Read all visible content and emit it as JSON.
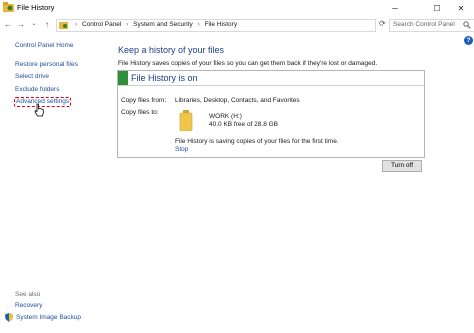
{
  "window": {
    "title": "File History",
    "minimize_glyph": "─",
    "maximize_glyph": "☐",
    "close_glyph": "✕"
  },
  "nav": {
    "back_glyph": "←",
    "forward_glyph": "→",
    "recent_glyph": "⌄",
    "up_glyph": "↑",
    "breadcrumb": [
      "Control Panel",
      "System and Security",
      "File History"
    ],
    "breadcrumb_sep": "›",
    "dropdown_glyph": "⌄",
    "refresh_glyph": "⟳",
    "search_placeholder": "Search Control Panel",
    "help_glyph": "?"
  },
  "sidebar": {
    "home": "Control Panel Home",
    "items": [
      "Restore personal files",
      "Select drive",
      "Exclude folders",
      "Advanced settings"
    ],
    "see_also_label": "See also",
    "see_also": [
      "Recovery",
      "System Image Backup"
    ]
  },
  "main": {
    "heading": "Keep a history of your files",
    "subtitle": "File History saves copies of your files so you can get them back if they're lost or damaged.",
    "status": "File History is on",
    "copy_from_label": "Copy files from:",
    "copy_from_value": "Libraries, Desktop, Contacts, and Favorites",
    "copy_to_label": "Copy files to:",
    "drive_name": "WORK (H:)",
    "drive_free": "40.0 KB free of 28.8 GB",
    "saving_message": "File History is saving copies of your files for the first time.",
    "stop_link": "Stop",
    "turn_off_button": "Turn off"
  },
  "colors": {
    "link": "#1e4fa0",
    "heading": "#1e3f8a",
    "status_green": "#2f8f3a",
    "highlight_dash": "#e0001a"
  }
}
